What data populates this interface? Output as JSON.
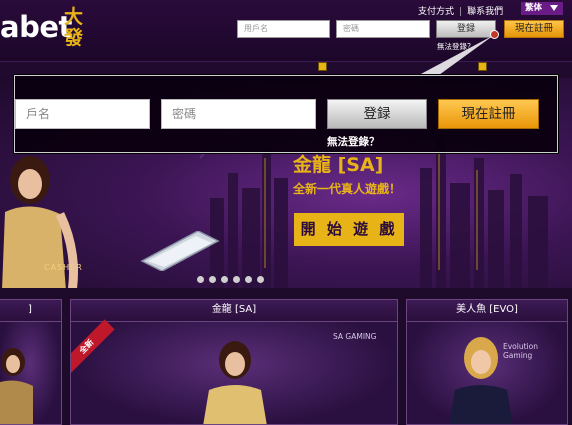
{
  "header": {
    "logo_text": "abet",
    "logo_cn": "大發",
    "links": [
      "支付方式",
      "聯系我們"
    ],
    "lang": "繁体",
    "username_placeholder": "用戶名",
    "password_placeholder": "密碼",
    "login_label": "登録",
    "register_label": "現在註冊",
    "forgot_label": "無法登錄？"
  },
  "popup": {
    "username_placeholder": "戶名",
    "password_placeholder": "密碼",
    "login_label": "登録",
    "register_label": "現在註冊",
    "forgot_label": "無法登錄？"
  },
  "hero": {
    "title": "金龍 [SA]",
    "subtitle": "全新一代真人遊戲！",
    "play_label": "開 始 遊 戲",
    "table_text": "CASHER",
    "slides": 6
  },
  "games": [
    {
      "label": "]"
    },
    {
      "label": "金龍 [SA]",
      "badge": "全新",
      "logo": "SA GAMING"
    },
    {
      "label": "美人魚 [EVO]",
      "logo": "Evolution Gaming"
    }
  ],
  "colors": {
    "gold": "#e8b317",
    "purple_dark": "#1c0729",
    "register": "#f0a018"
  }
}
